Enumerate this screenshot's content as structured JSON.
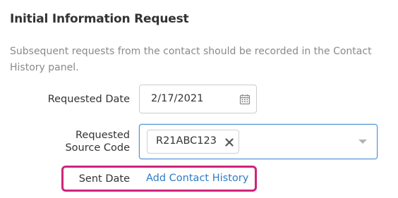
{
  "section": {
    "title": "Initial Information Request",
    "description": "Subsequent requests from the contact should be recorded in the Contact History panel."
  },
  "requested_date": {
    "label": "Requested Date",
    "value": "2/17/2021",
    "icon": "calendar-icon"
  },
  "requested_source_code": {
    "label_line1": "Requested",
    "label_line2": "Source Code",
    "selected_tags": [
      "R21ABC123"
    ],
    "remove_icon": "close-icon",
    "dropdown_icon": "chevron-down-icon"
  },
  "sent_date": {
    "label": "Sent Date",
    "link_text": "Add Contact History",
    "highlight_color": "#d0237b"
  },
  "colors": {
    "link": "#2f7cc4",
    "focus_border": "#4a8fd4",
    "muted_text": "#8a8a8a"
  }
}
